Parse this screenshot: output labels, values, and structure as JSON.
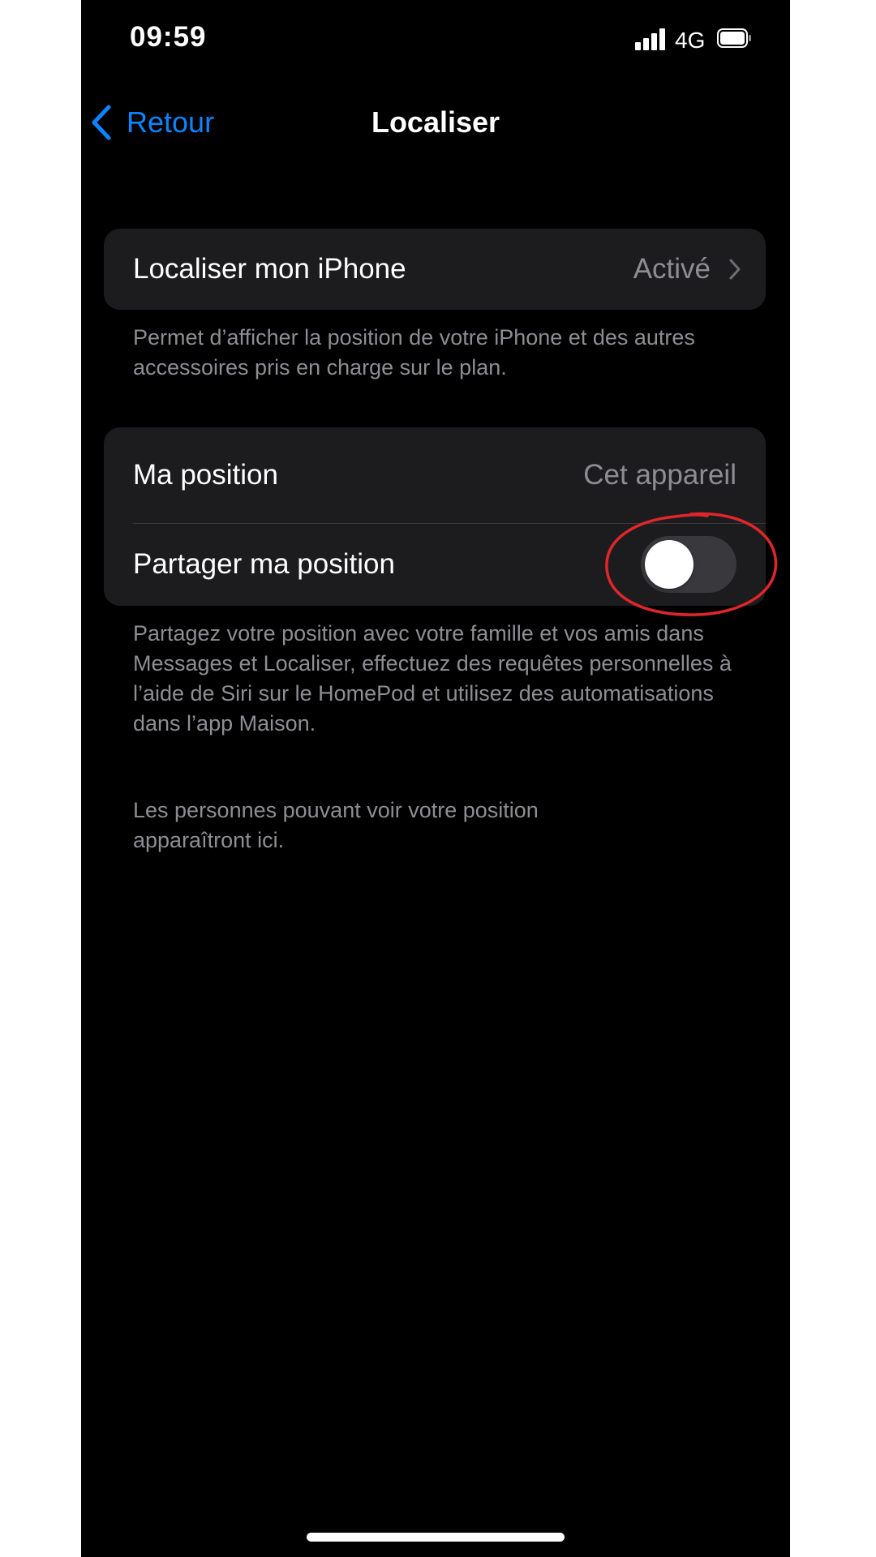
{
  "status_bar": {
    "time": "09:59",
    "network": "4G",
    "icons": [
      "signal-icon",
      "battery-icon"
    ]
  },
  "nav": {
    "back_label": "Retour",
    "title": "Localiser",
    "icons": [
      "chevron-left-icon"
    ]
  },
  "find_my_group": {
    "row_label": "Localiser mon iPhone",
    "row_value": "Activé",
    "footer": "Permet d’afficher la position de votre iPhone et des autres accessoires pris en charge sur le plan."
  },
  "location_group": {
    "my_location_label": "Ma position",
    "my_location_value": "Cet appareil",
    "share_label": "Partager ma position",
    "share_enabled": false,
    "footer": "Partagez votre position avec votre famille et vos amis dans Messages et Localiser, effectuez des requêtes personnelles à l’aide de Siri sur le HomePod et utilisez des automatisations dans l’app Maison."
  },
  "people_note": "Les personnes pouvant voir votre position apparaîtront ici.",
  "colors": {
    "background": "#000000",
    "cell": "#1c1c1e",
    "accent": "#0a84ff",
    "secondary_text": "#8d8d93",
    "toggle_off": "#39393d",
    "annotation": "#e0262b"
  }
}
